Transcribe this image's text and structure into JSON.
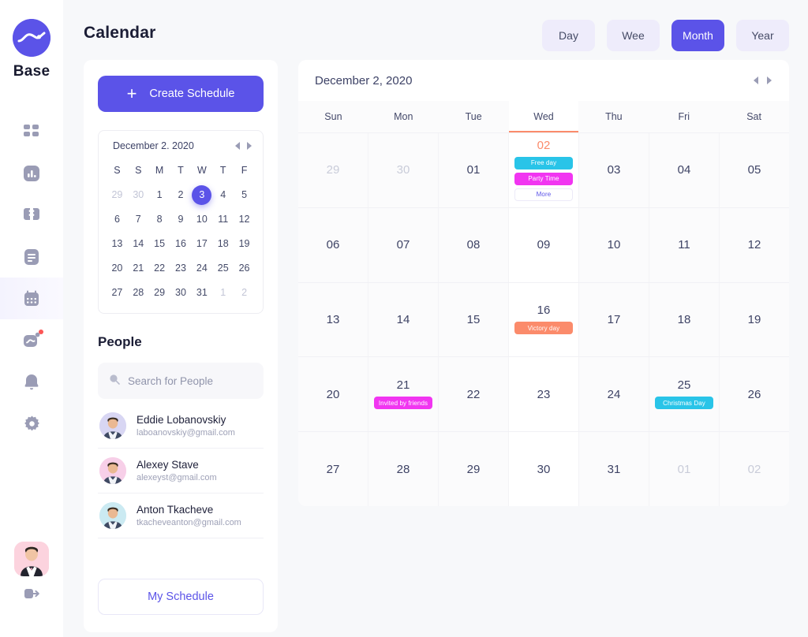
{
  "brand": {
    "name": "Base",
    "logo_icon": "wave-logo-icon"
  },
  "sidebar": {
    "items": [
      {
        "icon": "grid-dashboard-icon",
        "name": "dashboard",
        "active": false,
        "badge": false
      },
      {
        "icon": "bar-chart-icon",
        "name": "statistics",
        "active": false,
        "badge": false
      },
      {
        "icon": "ticket-icon",
        "name": "tickets",
        "active": false,
        "badge": false
      },
      {
        "icon": "document-list-icon",
        "name": "documents",
        "active": false,
        "badge": false
      },
      {
        "icon": "calendar-icon",
        "name": "calendar",
        "active": true,
        "badge": false
      },
      {
        "icon": "analytics-trend-icon",
        "name": "analytics",
        "active": false,
        "badge": true
      },
      {
        "icon": "bell-icon",
        "name": "notifications",
        "active": false,
        "badge": false
      },
      {
        "icon": "gear-icon",
        "name": "settings",
        "active": false,
        "badge": false
      }
    ],
    "user_avatar_icon": "user-avatar",
    "logout_icon": "logout-icon"
  },
  "header": {
    "title": "Calendar",
    "tabs": [
      {
        "label": "Day",
        "active": false
      },
      {
        "label": "Wee",
        "active": false
      },
      {
        "label": "Month",
        "active": true
      },
      {
        "label": "Year",
        "active": false
      }
    ]
  },
  "left_panel": {
    "create_button": {
      "label": "Create Schedule",
      "icon": "plus-icon"
    },
    "mini_calendar": {
      "title": "December 2. 2020",
      "prev_icon": "triangle-left-icon",
      "next_icon": "triangle-right-icon",
      "dow": [
        "S",
        "S",
        "M",
        "T",
        "W",
        "T",
        "F"
      ],
      "weeks": [
        [
          {
            "d": "29",
            "muted": true
          },
          {
            "d": "30",
            "muted": true
          },
          {
            "d": "1"
          },
          {
            "d": "2"
          },
          {
            "d": "3",
            "selected": true
          },
          {
            "d": "4"
          },
          {
            "d": "5"
          }
        ],
        [
          {
            "d": "6"
          },
          {
            "d": "7"
          },
          {
            "d": "8"
          },
          {
            "d": "9"
          },
          {
            "d": "10"
          },
          {
            "d": "11"
          },
          {
            "d": "12"
          }
        ],
        [
          {
            "d": "13"
          },
          {
            "d": "14"
          },
          {
            "d": "15"
          },
          {
            "d": "16"
          },
          {
            "d": "17"
          },
          {
            "d": "18"
          },
          {
            "d": "19"
          }
        ],
        [
          {
            "d": "20"
          },
          {
            "d": "21"
          },
          {
            "d": "22"
          },
          {
            "d": "23"
          },
          {
            "d": "24"
          },
          {
            "d": "25"
          },
          {
            "d": "26"
          }
        ],
        [
          {
            "d": "27"
          },
          {
            "d": "28"
          },
          {
            "d": "29"
          },
          {
            "d": "30"
          },
          {
            "d": "31"
          },
          {
            "d": "1",
            "muted": true
          },
          {
            "d": "2",
            "muted": true
          }
        ]
      ]
    },
    "people": {
      "title": "People",
      "search": {
        "placeholder": "Search for People",
        "value": "",
        "icon": "search-icon"
      },
      "list": [
        {
          "name": "Eddie Lobanovskiy",
          "email": "laboanovskiy@gmail.com",
          "avatar_bg": "#d8d6f3"
        },
        {
          "name": "Alexey Stave",
          "email": "alexeyst@gmail.com",
          "avatar_bg": "#f7cfe8"
        },
        {
          "name": "Anton Tkacheve",
          "email": "tkacheveanton@gmail.com",
          "avatar_bg": "#cbeaf2"
        }
      ]
    },
    "my_schedule_button": {
      "label": "My Schedule"
    }
  },
  "calendar": {
    "title": "December 2, 2020",
    "prev_icon": "triangle-left-icon",
    "next_icon": "triangle-right-icon",
    "dow": [
      "Sun",
      "Mon",
      "Tue",
      "Wed",
      "Thu",
      "Fri",
      "Sat"
    ],
    "today_column_index": 3,
    "weeks": [
      [
        {
          "d": "29",
          "muted": true,
          "events": []
        },
        {
          "d": "30",
          "muted": true,
          "events": []
        },
        {
          "d": "01",
          "events": []
        },
        {
          "d": "02",
          "today": true,
          "events": [
            {
              "label": "Free day",
              "color": "#29c4e8"
            },
            {
              "label": "Party Time",
              "color": "#f135f1"
            },
            {
              "label": "More",
              "style": "more"
            }
          ]
        },
        {
          "d": "03",
          "events": []
        },
        {
          "d": "04",
          "events": []
        },
        {
          "d": "05",
          "events": []
        }
      ],
      [
        {
          "d": "06",
          "events": []
        },
        {
          "d": "07",
          "events": []
        },
        {
          "d": "08",
          "events": []
        },
        {
          "d": "09",
          "events": []
        },
        {
          "d": "10",
          "events": []
        },
        {
          "d": "11",
          "events": []
        },
        {
          "d": "12",
          "events": []
        }
      ],
      [
        {
          "d": "13",
          "events": []
        },
        {
          "d": "14",
          "events": []
        },
        {
          "d": "15",
          "events": []
        },
        {
          "d": "16",
          "events": [
            {
              "label": "Victory day",
              "color": "#fb8b6b"
            }
          ]
        },
        {
          "d": "17",
          "events": []
        },
        {
          "d": "18",
          "events": []
        },
        {
          "d": "19",
          "events": []
        }
      ],
      [
        {
          "d": "20",
          "events": []
        },
        {
          "d": "21",
          "events": [
            {
              "label": "Invited by friends",
              "color": "#f135f1"
            }
          ]
        },
        {
          "d": "22",
          "events": []
        },
        {
          "d": "23",
          "events": []
        },
        {
          "d": "24",
          "events": []
        },
        {
          "d": "25",
          "events": [
            {
              "label": "Christmas Day",
              "color": "#29c4e8"
            }
          ]
        },
        {
          "d": "26",
          "events": []
        }
      ],
      [
        {
          "d": "27",
          "events": []
        },
        {
          "d": "28",
          "events": []
        },
        {
          "d": "29",
          "events": []
        },
        {
          "d": "30",
          "events": []
        },
        {
          "d": "31",
          "events": []
        },
        {
          "d": "01",
          "muted": true,
          "events": []
        },
        {
          "d": "02",
          "muted": true,
          "events": []
        }
      ]
    ]
  },
  "colors": {
    "accent": "#5b53e8",
    "today": "#fb8b6b",
    "cyan": "#29c4e8",
    "magenta": "#f135f1",
    "page_bg": "#f7f8fa"
  }
}
